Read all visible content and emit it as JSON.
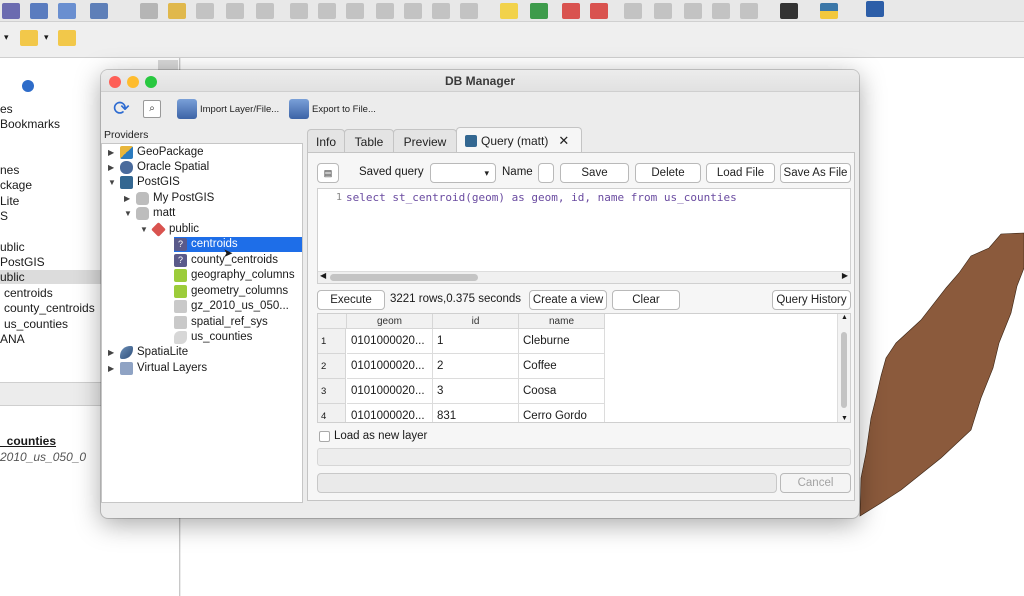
{
  "qgis": {
    "left_panel_lines": [
      "es",
      "Bookmarks",
      "nes",
      "ckage",
      "Lite",
      "S",
      "ublic",
      "PostGIS",
      "ublic",
      "centroids",
      "county_centroids",
      "us_counties",
      "ANA",
      "_counties",
      "2010_us_050_0"
    ],
    "map_fill_color": "#8b5a3c"
  },
  "window": {
    "title": "DB Manager",
    "toolbar": {
      "import_label": "Import Layer/File...",
      "export_label": "Export to File..."
    }
  },
  "providers": {
    "label": "Providers",
    "tree": [
      {
        "label": "GeoPackage"
      },
      {
        "label": "Oracle Spatial"
      },
      {
        "label": "PostGIS"
      },
      {
        "label": "My PostGIS"
      },
      {
        "label": "matt"
      },
      {
        "label": "public"
      },
      {
        "label": "centroids"
      },
      {
        "label": "county_centroids"
      },
      {
        "label": "geography_columns"
      },
      {
        "label": "geometry_columns"
      },
      {
        "label": "gz_2010_us_050..."
      },
      {
        "label": "spatial_ref_sys"
      },
      {
        "label": "us_counties"
      },
      {
        "label": "SpatiaLite"
      },
      {
        "label": "Virtual Layers"
      }
    ]
  },
  "tabs": [
    {
      "label": "Info"
    },
    {
      "label": "Table"
    },
    {
      "label": "Preview"
    },
    {
      "label": "Query (matt)"
    }
  ],
  "query": {
    "saved_query_label": "Saved query",
    "name_label": "Name",
    "save_label": "Save",
    "delete_label": "Delete",
    "load_file_label": "Load File",
    "save_as_file_label": "Save As File",
    "line_number": "1",
    "sql": "select st_centroid(geom) as geom, id, name from us_counties",
    "execute_label": "Execute",
    "status": "3221 rows,0.375 seconds",
    "create_view_label": "Create a view",
    "clear_label": "Clear",
    "history_label": "Query History",
    "load_layer_label": "Load as new layer",
    "cancel_label": "Cancel"
  },
  "results": {
    "columns": [
      "geom",
      "id",
      "name"
    ],
    "rows": [
      {
        "n": "1",
        "geom": "0101000020...",
        "id": "1",
        "name": "Cleburne"
      },
      {
        "n": "2",
        "geom": "0101000020...",
        "id": "2",
        "name": "Coffee"
      },
      {
        "n": "3",
        "geom": "0101000020...",
        "id": "3",
        "name": "Coosa"
      },
      {
        "n": "4",
        "geom": "0101000020...",
        "id": "831",
        "name": "Cerro Gordo"
      }
    ]
  }
}
